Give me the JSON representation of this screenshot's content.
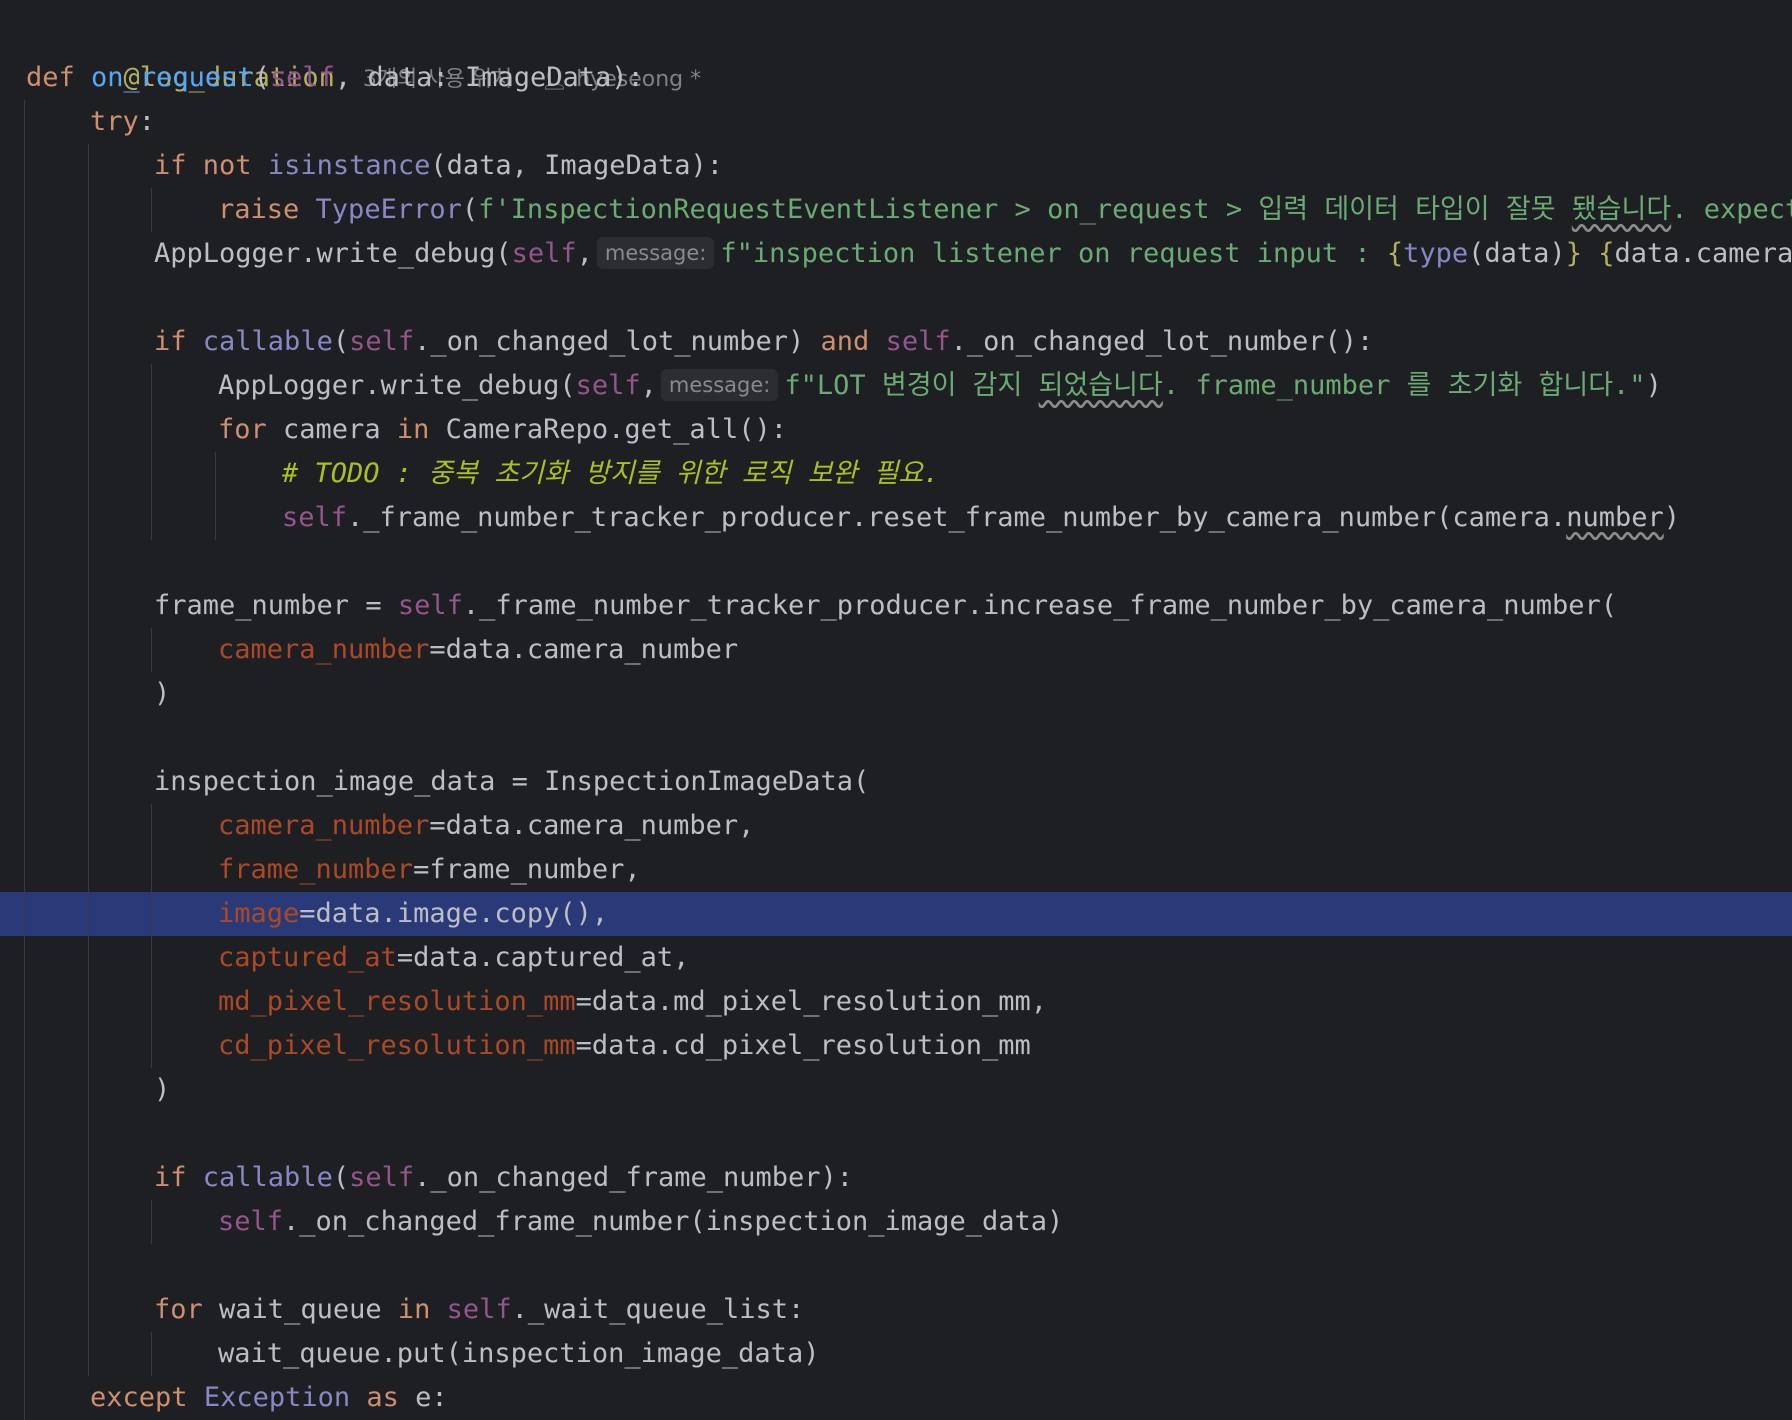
{
  "inlay": {
    "usages": "3개의 사용 위치",
    "author": "hyeseong *",
    "message_hint": "message:"
  },
  "icons": {
    "author": "person-icon"
  },
  "code": {
    "l1_decorator": "@log_duration",
    "l2_def": "def",
    "l2_fn": "on_request",
    "l2_open": "(",
    "l2_self": "self",
    "l2_rest": ", data: ImageData):",
    "l3_try": "try",
    "l3_colon": ":",
    "l4_if": "if",
    "l4_not": "not",
    "l4_isinstance": "isinstance",
    "l4_rest": "(data, ImageData):",
    "l5_raise": "raise",
    "l5_typeerror": "TypeError",
    "l5_paren": "(",
    "l5_str": "f'InspectionRequestEventListener > on_request > 입력 데이터 타입이 잘못 ",
    "l5_wavy": "됐습니다",
    "l5_str2": ". expect",
    "l6_call": "AppLogger.write_debug(",
    "l6_self": "self",
    "l6_comma": ",",
    "l6_str": "f\"inspection listener on request input : ",
    "l6_brace": "{",
    "l6_type": "type",
    "l6_rest": "(data)",
    "l6_brace2": "}",
    "l6_str2": " ",
    "l6_brace3": "{",
    "l6_rest2": "data.camera_",
    "l8_if": "if",
    "l8_callable": "callable",
    "l8_open": "(",
    "l8_self": "self",
    "l8_mid": "._on_changed_lot_number) ",
    "l8_and": "and",
    "l8_sp": " ",
    "l8_self2": "self",
    "l8_end": "._on_changed_lot_number():",
    "l9_call": "AppLogger.write_debug(",
    "l9_self": "self",
    "l9_comma": ",",
    "l9_str": "f\"LOT 변경이 감지 ",
    "l9_wavy": "되었습니다",
    "l9_str2": ". frame_number 를 초기화 합니다.\"",
    "l9_close": ")",
    "l10_for": "for",
    "l10_mid": " camera ",
    "l10_in": "in",
    "l10_end": " CameraRepo.get_all():",
    "l11_hash": "# ",
    "l11_todo": "TODO : 중복 초기화 방지를 위한 로직 보완 필요.",
    "l12_self": "self",
    "l12_mid": "._frame_number_tracker_producer.reset_frame_number_by_camera_number(camera.",
    "l12_wavy": "number",
    "l12_end": ")",
    "l14_lhs": "frame_number = ",
    "l14_self": "self",
    "l14_end": "._frame_number_tracker_producer.increase_frame_number_by_camera_number(",
    "l15_param": "camera_number",
    "l15_end": "=data.camera_number",
    "l16_close": ")",
    "l18_text": "inspection_image_data = InspectionImageData(",
    "l19_param": "camera_number",
    "l19_end": "=data.camera_number,",
    "l20_param": "frame_number",
    "l20_end": "=frame_number,",
    "l21_param": "image",
    "l21_end": "=data.image.copy(),",
    "l22_param": "captured_at",
    "l22_end": "=data.captured_at,",
    "l23_param": "md_pixel_resolution_mm",
    "l23_end": "=data.md_pixel_resolution_mm,",
    "l24_param": "cd_pixel_resolution_mm",
    "l24_end": "=data.cd_pixel_resolution_mm",
    "l25_close": ")",
    "l27_if": "if",
    "l27_callable": "callable",
    "l27_open": "(",
    "l27_self": "self",
    "l27_end": "._on_changed_frame_number):",
    "l28_self": "self",
    "l28_end": "._on_changed_frame_number(inspection_image_data)",
    "l30_for": "for",
    "l30_mid": " wait_queue ",
    "l30_in": "in",
    "l30_sp": " ",
    "l30_self": "self",
    "l30_end": "._wait_queue_list:",
    "l31_text": "wait_queue.put(inspection_image_data)",
    "l32_except": "except",
    "l32_sp": " ",
    "l32_exc": "Exception",
    "l32_sp2": " ",
    "l32_as": "as",
    "l32_end": " e:"
  }
}
